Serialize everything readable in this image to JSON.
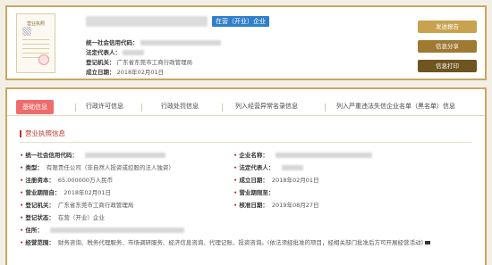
{
  "header": {
    "license_title": "营业执照",
    "status_tag": "在营（开业）企业",
    "credit_code_label": "统一社会信用代码：",
    "legal_rep_label": "法定代表人：",
    "registry_label": "登记机关：",
    "registry_value": "广东省东莞市工商行政管理局",
    "founded_label": "成立日期：",
    "founded_value": "2018年02月01日"
  },
  "actions": {
    "report": "发送报告",
    "share": "信息分享",
    "print": "信息打印"
  },
  "tabs": [
    {
      "label": "基础信息",
      "active": true
    },
    {
      "label": "行政许可信息",
      "active": false
    },
    {
      "label": "行政处罚信息",
      "active": false
    },
    {
      "label": "列入经营异常名录信息",
      "active": false
    },
    {
      "label": "列入严重违法失信企业名单（黑名单）信息",
      "active": false
    }
  ],
  "section": {
    "title": "营业执照信息"
  },
  "fields": {
    "credit_code": {
      "label": "统一社会信用代码："
    },
    "company_name": {
      "label": "企业名称："
    },
    "type": {
      "label": "类型：",
      "value": "有限责任公司（非自然人投资或控股的法人独资）"
    },
    "legal_rep": {
      "label": "法定代表人："
    },
    "capital": {
      "label": "注册资本：",
      "value": "65.000000万人民币"
    },
    "founded": {
      "label": "成立日期：",
      "value": "2018年02月01日"
    },
    "term_from": {
      "label": "营业期限自：",
      "value": "2018年02月01日"
    },
    "term_to": {
      "label": "营业期限至："
    },
    "registry": {
      "label": "登记机关：",
      "value": "广东省东莞市工商行政管理局"
    },
    "approved": {
      "label": "核准日期：",
      "value": "2019年08月27日"
    },
    "reg_status": {
      "label": "登记状态：",
      "value": "在营（开业）企业"
    },
    "address": {
      "label": "住所："
    },
    "scope": {
      "label": "经营范围：",
      "value": "财务咨询、税务代理服务、市场调研服务、经济信息咨询、代理记账、投资咨询。(依法须经批准的项目，经相关部门批准后方可开展经营活动)"
    }
  },
  "colors": {
    "gold_border": "#c9a860",
    "status_blue": "#2f80c9",
    "tab_active": "#f06b6b",
    "accent_red": "#c0392b"
  }
}
